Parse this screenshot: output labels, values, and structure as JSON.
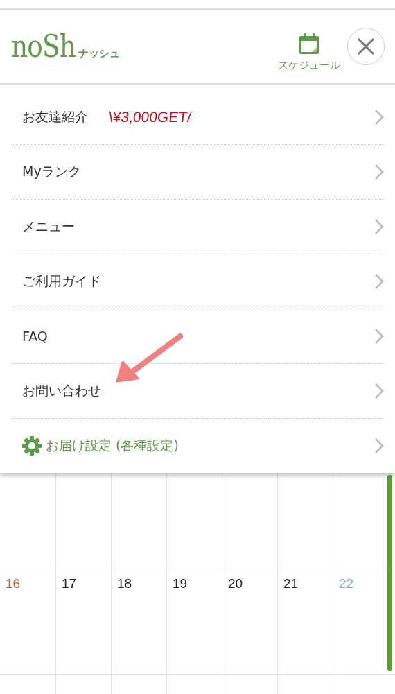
{
  "header": {
    "logo": "noSh",
    "logo_sub": "ナッシュ",
    "schedule_label": "スケジュール"
  },
  "menu": [
    {
      "kind": "promo",
      "label": "お友達紹介",
      "promo": "\\¥3,000GET/"
    },
    {
      "kind": "link",
      "label": "Myランク"
    },
    {
      "kind": "link",
      "label": "メニュー"
    },
    {
      "kind": "link",
      "label": "ご利用ガイド"
    },
    {
      "kind": "link",
      "label": "FAQ"
    },
    {
      "kind": "link",
      "label": "お問い合わせ"
    },
    {
      "kind": "settings",
      "label": "お届け設定 (各種設定)"
    }
  ],
  "calendar": {
    "weeks": [
      {
        "days": [
          {
            "day": "16",
            "kind": "sunday"
          },
          {
            "day": "17",
            "kind": "weekday"
          },
          {
            "day": "18",
            "kind": "weekday"
          },
          {
            "day": "19",
            "kind": "weekday"
          },
          {
            "day": "20",
            "kind": "weekday"
          },
          {
            "day": "21",
            "kind": "weekday"
          },
          {
            "day": "22",
            "kind": "saturday"
          }
        ]
      }
    ]
  }
}
